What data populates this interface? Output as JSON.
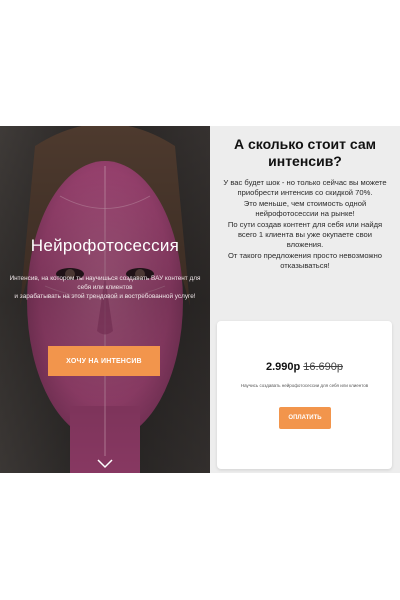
{
  "hero": {
    "title": "Нейрофотосессия",
    "description_line1": "Интенсив, на котором ты научишься создавать ВАУ контент для себя или клиентов",
    "description_line2": "и зарабатывать на этой трендовой и востребованной услуге!",
    "cta_label": "ХОЧУ НА ИНТЕНСИВ",
    "scroll_icon": "chevron-down-icon"
  },
  "info": {
    "title": "А сколько стоит сам интенсив?",
    "paragraphs": [
      "У вас будет шок - но только сейчас вы можете приобрести интенсив со скидкой 70%.",
      "Это меньше, чем стоимость одной нейрофотосессии на рынке!",
      "По сути создав контент для себя или найдя всего 1 клиента вы уже окупаете свои вложения.",
      "От такого предложения просто невозможно отказываться!"
    ]
  },
  "card": {
    "price_new": "2.990р",
    "price_old": "16.690р",
    "note": "Научись создавать нейрофотосессии для себя или клиентов",
    "pay_label": "ОПЛАТИТЬ"
  },
  "colors": {
    "accent": "#f2954c",
    "mask_pink": "#c8578e",
    "panel_gray": "#ededed"
  }
}
